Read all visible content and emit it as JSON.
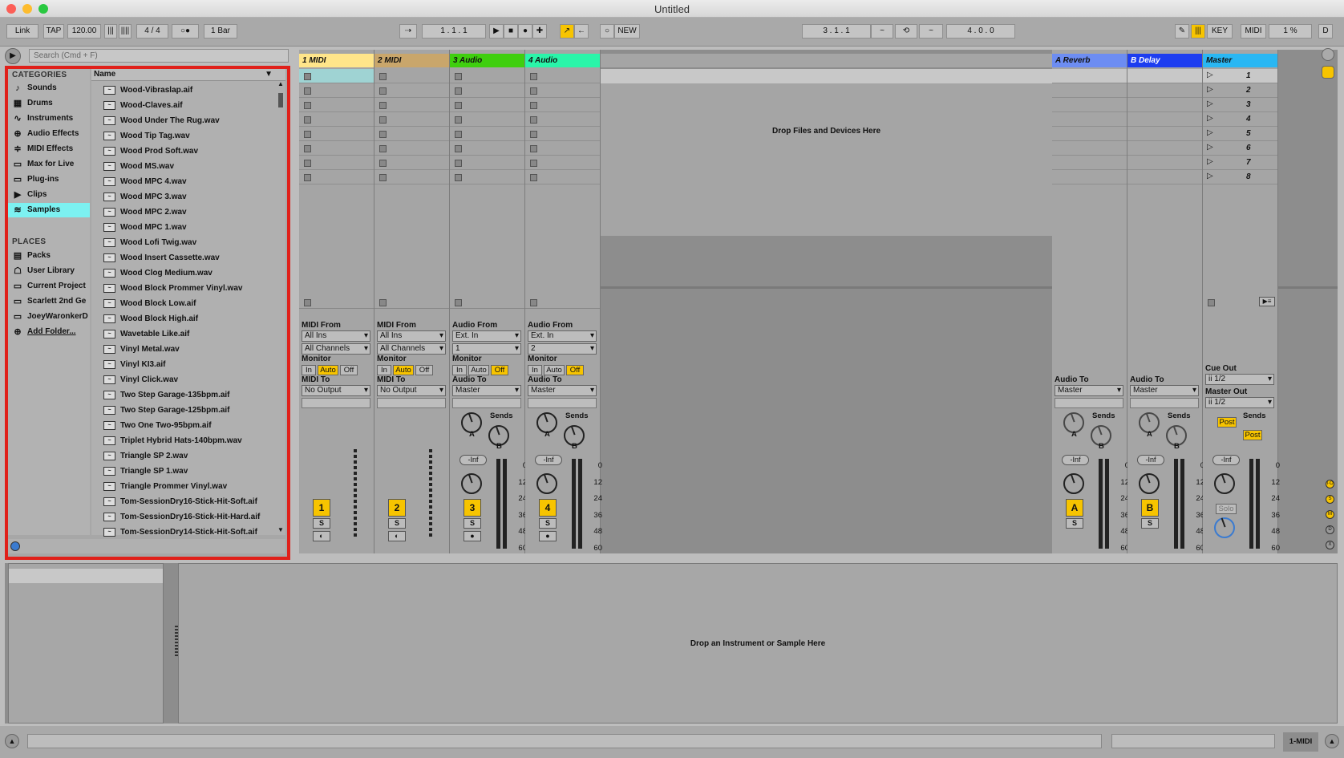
{
  "window": {
    "title": "Untitled"
  },
  "toolbar": {
    "link": "Link",
    "tap": "TAP",
    "tempo": "120.00",
    "signature": "4 / 4",
    "quantize": "1 Bar",
    "position": "1 .   1 .   1",
    "new_label": "NEW",
    "loop_start": "3 .   1 .   1",
    "loop_length": "4 .   0 .   0",
    "key": "KEY",
    "midi": "MIDI",
    "cpu": "1 %",
    "d": "D"
  },
  "browser": {
    "search_placeholder": "Search (Cmd + F)",
    "categories_title": "CATEGORIES",
    "places_title": "PLACES",
    "name_header": "Name",
    "categories": [
      {
        "label": "Sounds",
        "icon": "note-icon"
      },
      {
        "label": "Drums",
        "icon": "grid-icon"
      },
      {
        "label": "Instruments",
        "icon": "wave-icon"
      },
      {
        "label": "Audio Effects",
        "icon": "fx-icon"
      },
      {
        "label": "MIDI Effects",
        "icon": "midi-fx-icon"
      },
      {
        "label": "Max for Live",
        "icon": "max-icon"
      },
      {
        "label": "Plug-ins",
        "icon": "plug-icon"
      },
      {
        "label": "Clips",
        "icon": "clip-icon"
      },
      {
        "label": "Samples",
        "icon": "sample-icon"
      }
    ],
    "selected_category": "Samples",
    "places": [
      {
        "label": "Packs",
        "icon": "packs-icon"
      },
      {
        "label": "User Library",
        "icon": "user-icon"
      },
      {
        "label": "Current Project",
        "icon": "folder-icon"
      },
      {
        "label": "Scarlett 2nd Ge",
        "icon": "folder-icon"
      },
      {
        "label": "JoeyWaronkerD",
        "icon": "folder-icon"
      },
      {
        "label": "Add Folder...",
        "icon": "add-icon"
      }
    ],
    "files": [
      "Wood-Vibraslap.aif",
      "Wood-Claves.aif",
      "Wood Under The Rug.wav",
      "Wood Tip Tag.wav",
      "Wood Prod Soft.wav",
      "Wood MS.wav",
      "Wood MPC 4.wav",
      "Wood MPC 3.wav",
      "Wood MPC 2.wav",
      "Wood MPC 1.wav",
      "Wood Lofi Twig.wav",
      "Wood Insert Cassette.wav",
      "Wood Clog Medium.wav",
      "Wood Block Prommer Vinyl.wav",
      "Wood Block Low.aif",
      "Wood Block High.aif",
      "Wavetable Like.aif",
      "Vinyl Metal.wav",
      "Vinyl KI3.aif",
      "Vinyl Click.wav",
      "Two Step Garage-135bpm.aif",
      "Two Step Garage-125bpm.aif",
      "Two One Two-95bpm.aif",
      "Triplet Hybrid Hats-140bpm.wav",
      "Triangle SP 2.wav",
      "Triangle SP 1.wav",
      "Triangle Prommer Vinyl.wav",
      "Tom-SessionDry16-Stick-Hit-Soft.aif",
      "Tom-SessionDry16-Stick-Hit-Hard.aif",
      "Tom-SessionDry14-Stick-Hit-Soft.aif"
    ]
  },
  "session": {
    "drop_text": "Drop Files and Devices Here",
    "tracks": [
      {
        "name": "1 MIDI",
        "color": "#ffe58a",
        "type": "midi",
        "from_label": "MIDI From",
        "from": "All Ins",
        "channel": "All Channels",
        "to_label": "MIDI To",
        "to": "No Output",
        "num": "1"
      },
      {
        "name": "2 MIDI",
        "color": "#c9a66b",
        "type": "midi",
        "from_label": "MIDI From",
        "from": "All Ins",
        "channel": "All Channels",
        "to_label": "MIDI To",
        "to": "No Output",
        "num": "2"
      },
      {
        "name": "3 Audio",
        "color": "#3fcf0e",
        "type": "audio",
        "from_label": "Audio From",
        "from": "Ext. In",
        "channel": "1",
        "to_label": "Audio To",
        "to": "Master",
        "num": "3"
      },
      {
        "name": "4 Audio",
        "color": "#2af5a9",
        "type": "audio",
        "from_label": "Audio From",
        "from": "Ext. In",
        "channel": "2",
        "to_label": "Audio To",
        "to": "Master",
        "num": "4"
      }
    ],
    "returns": [
      {
        "name": "A Reverb",
        "color": "#6d8df2",
        "to_label": "Audio To",
        "to": "Master",
        "num": "A"
      },
      {
        "name": "B Delay",
        "color": "#1d3df0",
        "to_label": "Audio To",
        "to": "Master",
        "num": "B"
      }
    ],
    "master": {
      "name": "Master",
      "color": "#29b7f3",
      "scenes": [
        "1",
        "2",
        "3",
        "4",
        "5",
        "6",
        "7",
        "8"
      ],
      "cue_label": "Cue Out",
      "cue": "ii 1/2",
      "out_label": "Master Out",
      "out": "ii 1/2",
      "post": "Post",
      "solo": "Solo"
    },
    "monitor_label": "Monitor",
    "mon_in": "In",
    "mon_auto": "Auto",
    "mon_off": "Off",
    "sends": "Sends",
    "send_a": "A",
    "send_b": "B",
    "vol": "-Inf",
    "solo_s": "S",
    "scale": [
      "0",
      "12",
      "24",
      "36",
      "48",
      "60"
    ]
  },
  "detail": {
    "drop_text": "Drop an Instrument or Sample Here"
  },
  "status": {
    "track": "1-MIDI"
  }
}
